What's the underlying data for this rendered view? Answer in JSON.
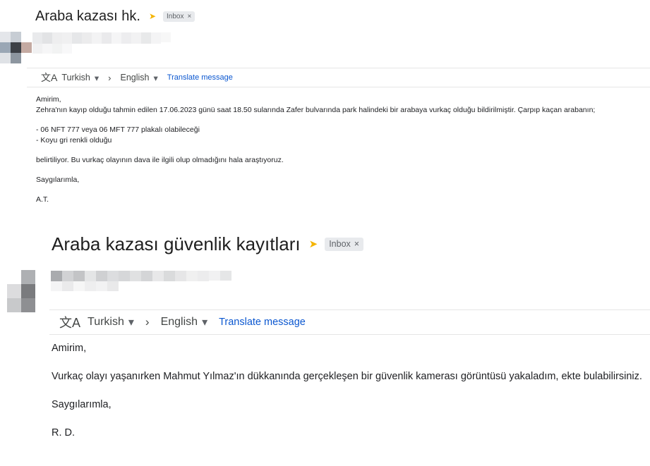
{
  "emails": [
    {
      "subject": "Araba kazası hk.",
      "importance_icon": "importance-marker",
      "label": "Inbox",
      "label_close": "×",
      "translate": {
        "icon": "translate-icon",
        "source_lang": "Turkish",
        "target_lang": "English",
        "caret": "▾",
        "arrow": "›",
        "action": "Translate message"
      },
      "body": {
        "greeting": "Amirim,",
        "line1": "Zehra'nın kayıp olduğu tahmin edilen 17.06.2023 günü saat 18.50 sularında Zafer bulvarında park halindeki bir arabaya vurkaç olduğu bildirilmiştir. Çarpıp kaçan arabanın;",
        "bullet1": "- 06 NFT 777 veya 06 MFT 777 plakalı olabileceği",
        "bullet2": "- Koyu gri renkli olduğu",
        "line2": "belirtiliyor. Bu vurkaç olayının dava ile ilgili olup olmadığını hala araştıyoruz.",
        "closing": "Saygılarımla,",
        "signature": "A.T."
      }
    },
    {
      "subject": "Araba kazası güvenlik kayıtları",
      "importance_icon": "importance-marker",
      "label": "Inbox",
      "label_close": "×",
      "translate": {
        "icon": "translate-icon",
        "source_lang": "Turkish",
        "target_lang": "English",
        "caret": "▾",
        "arrow": "›",
        "action": "Translate message"
      },
      "body": {
        "greeting": "Amirim,",
        "line1": "Vurkaç olayı yaşanırken Mahmut Yılmaz'ın dükkanında gerçekleşen bir güvenlik kamerası görüntüsü yakaladım, ekte bulabilirsiniz.",
        "closing": "Saygılarımla,",
        "signature": "R. D."
      }
    }
  ],
  "colors": {
    "importance": "#f4b400",
    "link": "#0b57d0",
    "chip_bg": "#e8eaed"
  }
}
